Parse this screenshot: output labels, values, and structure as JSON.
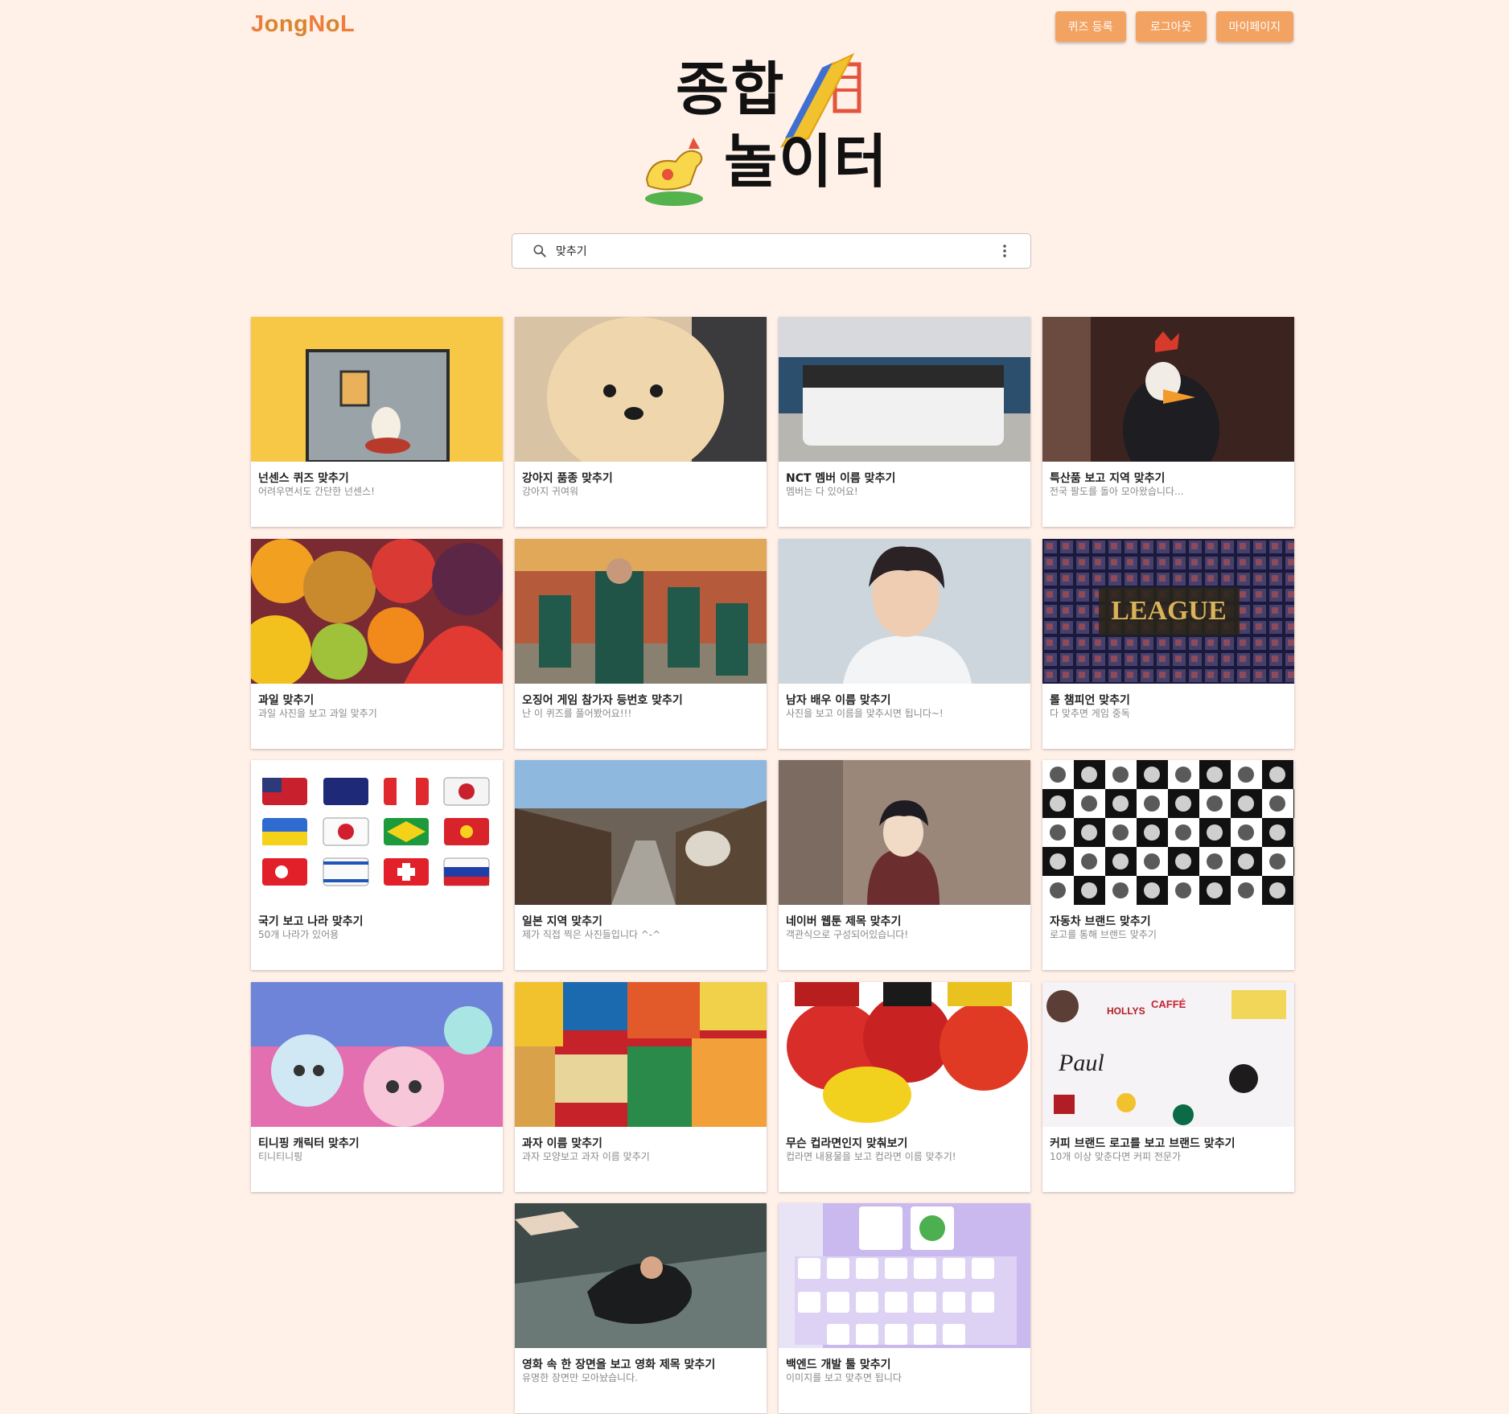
{
  "header": {
    "logo": {
      "p1": "J",
      "p2": "ong",
      "p3": "N",
      "p4": "o",
      "p5": "L"
    },
    "buttons": {
      "register": "퀴즈 등록",
      "logout": "로그아웃",
      "mypage": "마이페이지"
    }
  },
  "hero": {
    "line1": "종합",
    "line2": "놀이터"
  },
  "search": {
    "value": "맞추기",
    "icon": "search-icon",
    "menu_icon": "more-vert-icon"
  },
  "colors": {
    "accent": "#f2a261",
    "background": "#fff0e8",
    "logo_orange": "#ef7c3a"
  },
  "cards": [
    {
      "title": "넌센스 퀴즈 맞추기",
      "desc": "어려우면서도 간단한 넌센스!"
    },
    {
      "title": "강아지 품종 맞추기",
      "desc": "강아지 귀여워"
    },
    {
      "title": "NCT 멤버 이름 맞추기",
      "desc": "멤버는 다 있어요!"
    },
    {
      "title": "특산품 보고 지역 맞추기",
      "desc": "전국 팔도를 돌아 모아왔습니다..."
    },
    {
      "title": "과일 맞추기",
      "desc": "과일 사진을 보고 과일 맞추기"
    },
    {
      "title": "오징어 게임 참가자 등번호 맞추기",
      "desc": "난 이 퀴즈를 풀어봤어요!!!"
    },
    {
      "title": "남자 배우 이름 맞추기",
      "desc": "사진을 보고 이름을 맞추시면 됩니다~!"
    },
    {
      "title": "롤 챔피언 맞추기",
      "desc": "다 맞추면 게임 중독"
    },
    {
      "title": "국기 보고 나라 맞추기",
      "desc": "50개 나라가 있어용"
    },
    {
      "title": "일본 지역 맞추기",
      "desc": "제가 직접 찍은 사진들입니다 ^-^"
    },
    {
      "title": "네이버 웹툰 제목 맞추기",
      "desc": "객관식으로 구성되어있습니다!"
    },
    {
      "title": "자동차 브랜드 맞추기",
      "desc": "로고를 통해 브랜드 맞추기"
    },
    {
      "title": "티니핑 캐릭터 맞추기",
      "desc": "티니티니핑"
    },
    {
      "title": "과자 이름 맞추기",
      "desc": "과자 모양보고 과자 이름 맞추기"
    },
    {
      "title": "무슨 컵라면인지 맞춰보기",
      "desc": "컵라면 내용물을 보고 컵라면 이름 맞추기!"
    },
    {
      "title": "커피 브랜드 로고를 보고 브랜드 맞추기",
      "desc": "10개 이상 맞춘다면 커피 전문가"
    },
    {
      "title": "영화 속 한 장면을 보고 영화 제목 맞추기",
      "desc": "유명한 장면만 모아놨습니다."
    },
    {
      "title": "백엔드 개발 툴 맞추기",
      "desc": "이미지를 보고 맞추면 됩니다"
    }
  ]
}
